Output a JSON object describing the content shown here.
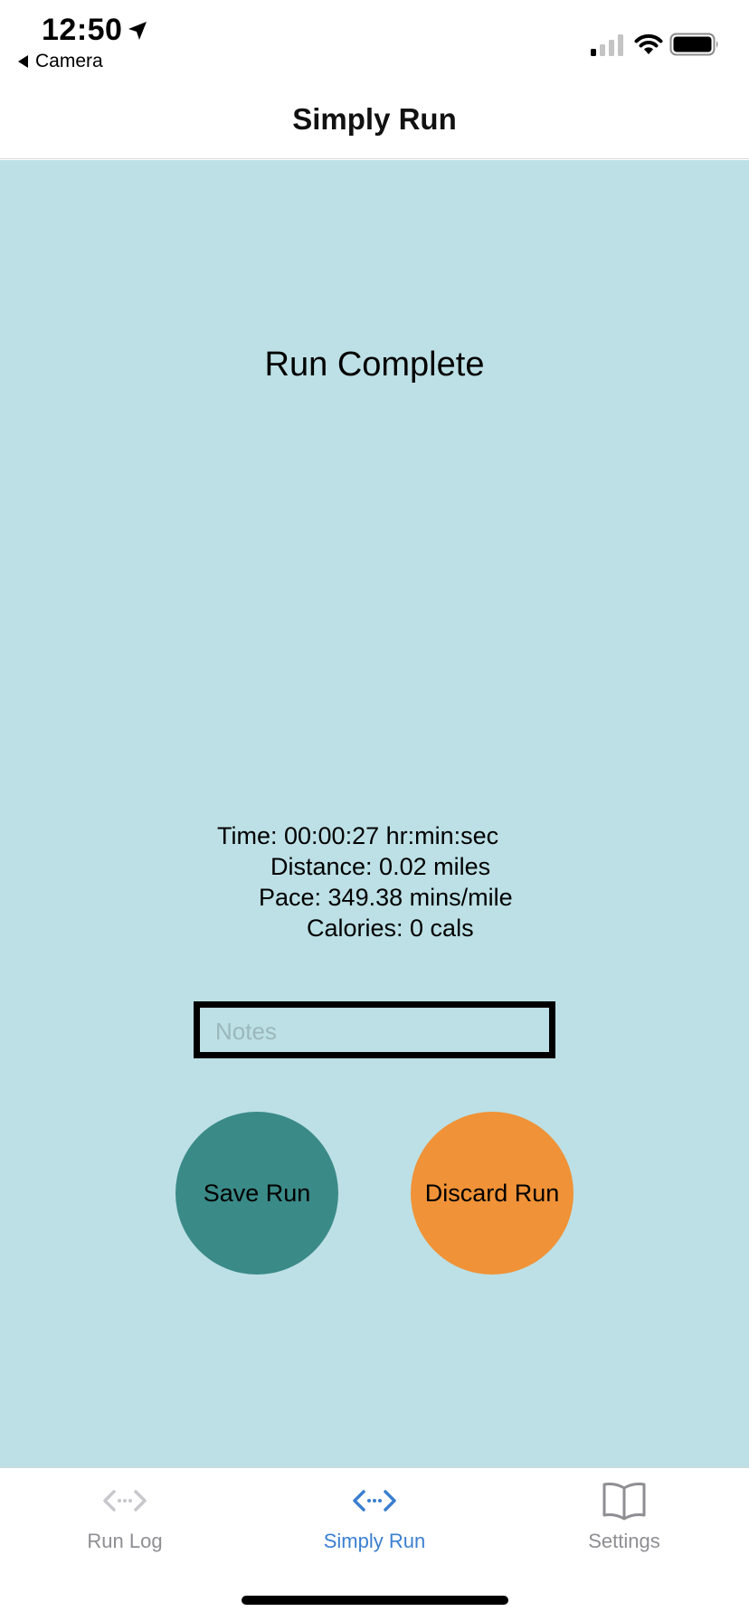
{
  "status_bar": {
    "time": "12:50",
    "back_app": "Camera",
    "icons": [
      "location-arrow-icon",
      "cellular-signal-icon",
      "wifi-icon",
      "battery-icon"
    ]
  },
  "nav": {
    "title": "Simply Run"
  },
  "main": {
    "heading": "Run Complete",
    "stats": {
      "time": "Time: 00:00:27 hr:min:sec",
      "distance": "Distance: 0.02 miles",
      "pace": "Pace: 349.38 mins/mile",
      "calories": "Calories: 0 cals"
    },
    "notes": {
      "placeholder": "Notes",
      "value": ""
    },
    "save_label": "Save Run",
    "discard_label": "Discard Run"
  },
  "tabs": [
    {
      "label": "Run Log",
      "icon": "code-arrows-icon",
      "active": false
    },
    {
      "label": "Simply Run",
      "icon": "code-arrows-icon",
      "active": true
    },
    {
      "label": "Settings",
      "icon": "open-book-icon",
      "active": false
    }
  ],
  "colors": {
    "background": "#bce0e5",
    "save_button": "#3a8a88",
    "discard_button": "#f09237",
    "tab_active": "#3b7fd0",
    "tab_inactive": "#8e8e93"
  }
}
